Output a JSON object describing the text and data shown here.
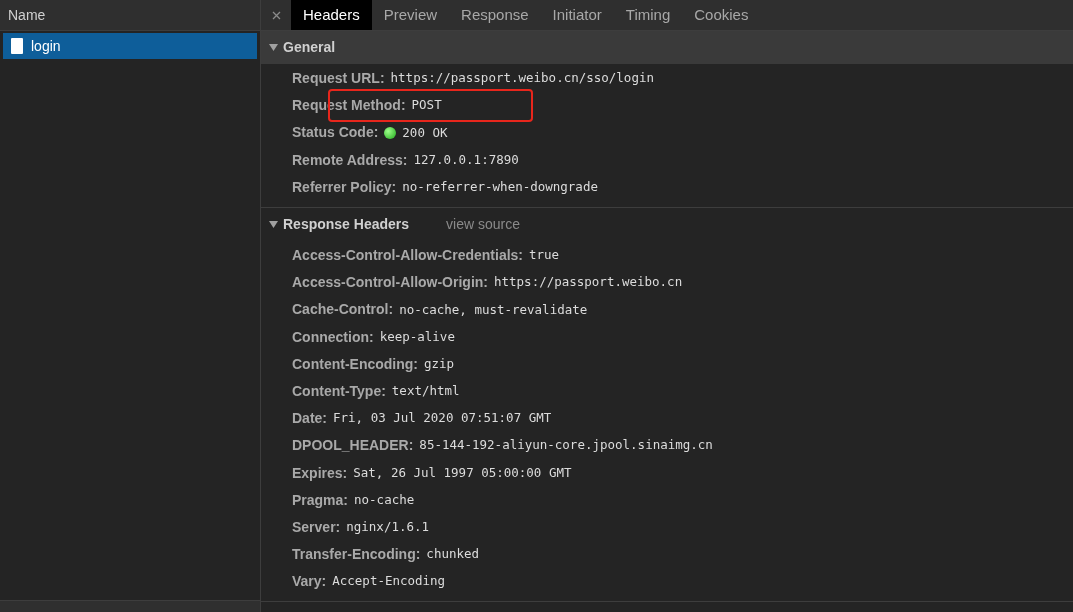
{
  "sidebar": {
    "column_header": "Name",
    "items": [
      {
        "label": "login",
        "selected": true
      }
    ]
  },
  "tabs": [
    {
      "label": "Headers",
      "selected": true
    },
    {
      "label": "Preview",
      "selected": false
    },
    {
      "label": "Response",
      "selected": false
    },
    {
      "label": "Initiator",
      "selected": false
    },
    {
      "label": "Timing",
      "selected": false
    },
    {
      "label": "Cookies",
      "selected": false
    }
  ],
  "sections": [
    {
      "title": "General",
      "expanded": true,
      "shaded": true,
      "rows": [
        {
          "key": "Request URL:",
          "value": "https://passport.weibo.cn/sso/login",
          "highlighted": false
        },
        {
          "key": "Request Method:",
          "value": "POST",
          "highlighted": true
        },
        {
          "key": "Status Code:",
          "value": "200 OK",
          "highlighted": false
        },
        {
          "key": "Remote Address:",
          "value": "127.0.0.1:7890",
          "highlighted": false
        },
        {
          "key": "Referrer Policy:",
          "value": "no-referrer-when-downgrade",
          "highlighted": false
        }
      ]
    },
    {
      "title": "Response Headers",
      "expanded": true,
      "shaded": false,
      "link": "view source",
      "rows": [
        {
          "key": "Access-Control-Allow-Credentials:",
          "value": "true",
          "highlighted": false
        },
        {
          "key": "Access-Control-Allow-Origin:",
          "value": "https://passport.weibo.cn",
          "highlighted": false
        },
        {
          "key": "Cache-Control:",
          "value": "no-cache, must-revalidate",
          "highlighted": false
        },
        {
          "key": "Connection:",
          "value": "keep-alive",
          "highlighted": false
        },
        {
          "key": "Content-Encoding:",
          "value": "gzip",
          "highlighted": false
        },
        {
          "key": "Content-Type:",
          "value": "text/html",
          "highlighted": false
        },
        {
          "key": "Date:",
          "value": "Fri, 03 Jul 2020 07:51:07 GMT",
          "highlighted": false
        },
        {
          "key": "DPOOL_HEADER:",
          "value": "85-144-192-aliyun-core.jpool.sinaimg.cn",
          "highlighted": false
        },
        {
          "key": "Expires:",
          "value": "Sat, 26 Jul 1997 05:00:00 GMT",
          "highlighted": false
        },
        {
          "key": "Pragma:",
          "value": "no-cache",
          "highlighted": false
        },
        {
          "key": "Server:",
          "value": "nginx/1.6.1",
          "highlighted": false
        },
        {
          "key": "Transfer-Encoding:",
          "value": "chunked",
          "highlighted": false
        },
        {
          "key": "Vary:",
          "value": "Accept-Encoding",
          "highlighted": false
        }
      ]
    }
  ]
}
